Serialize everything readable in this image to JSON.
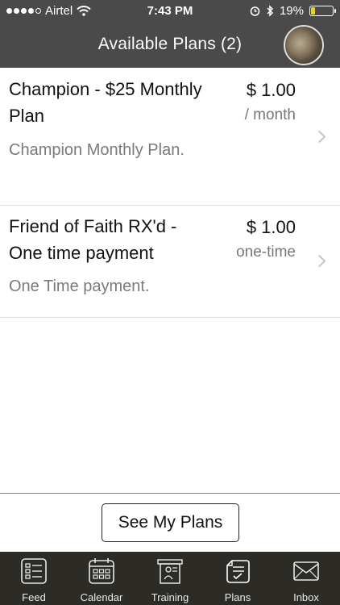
{
  "status_bar": {
    "carrier": "Airtel",
    "time": "7:43 PM",
    "battery": "19%"
  },
  "header": {
    "title": "Available Plans (2)"
  },
  "plans": [
    {
      "name": "Champion - $25 Monthly Plan",
      "price": "$ 1.00",
      "period": "/ month",
      "description": "Champion Monthly Plan."
    },
    {
      "name": "Friend of Faith RX'd - One time payment",
      "price": "$ 1.00",
      "period": "one-time",
      "description": "One Time payment."
    }
  ],
  "see_my_plans_label": "See My Plans",
  "tabs": [
    {
      "label": "Feed",
      "icon": "feed-icon"
    },
    {
      "label": "Calendar",
      "icon": "calendar-icon"
    },
    {
      "label": "Training",
      "icon": "training-icon"
    },
    {
      "label": "Plans",
      "icon": "plans-icon"
    },
    {
      "label": "Inbox",
      "icon": "inbox-icon"
    }
  ]
}
